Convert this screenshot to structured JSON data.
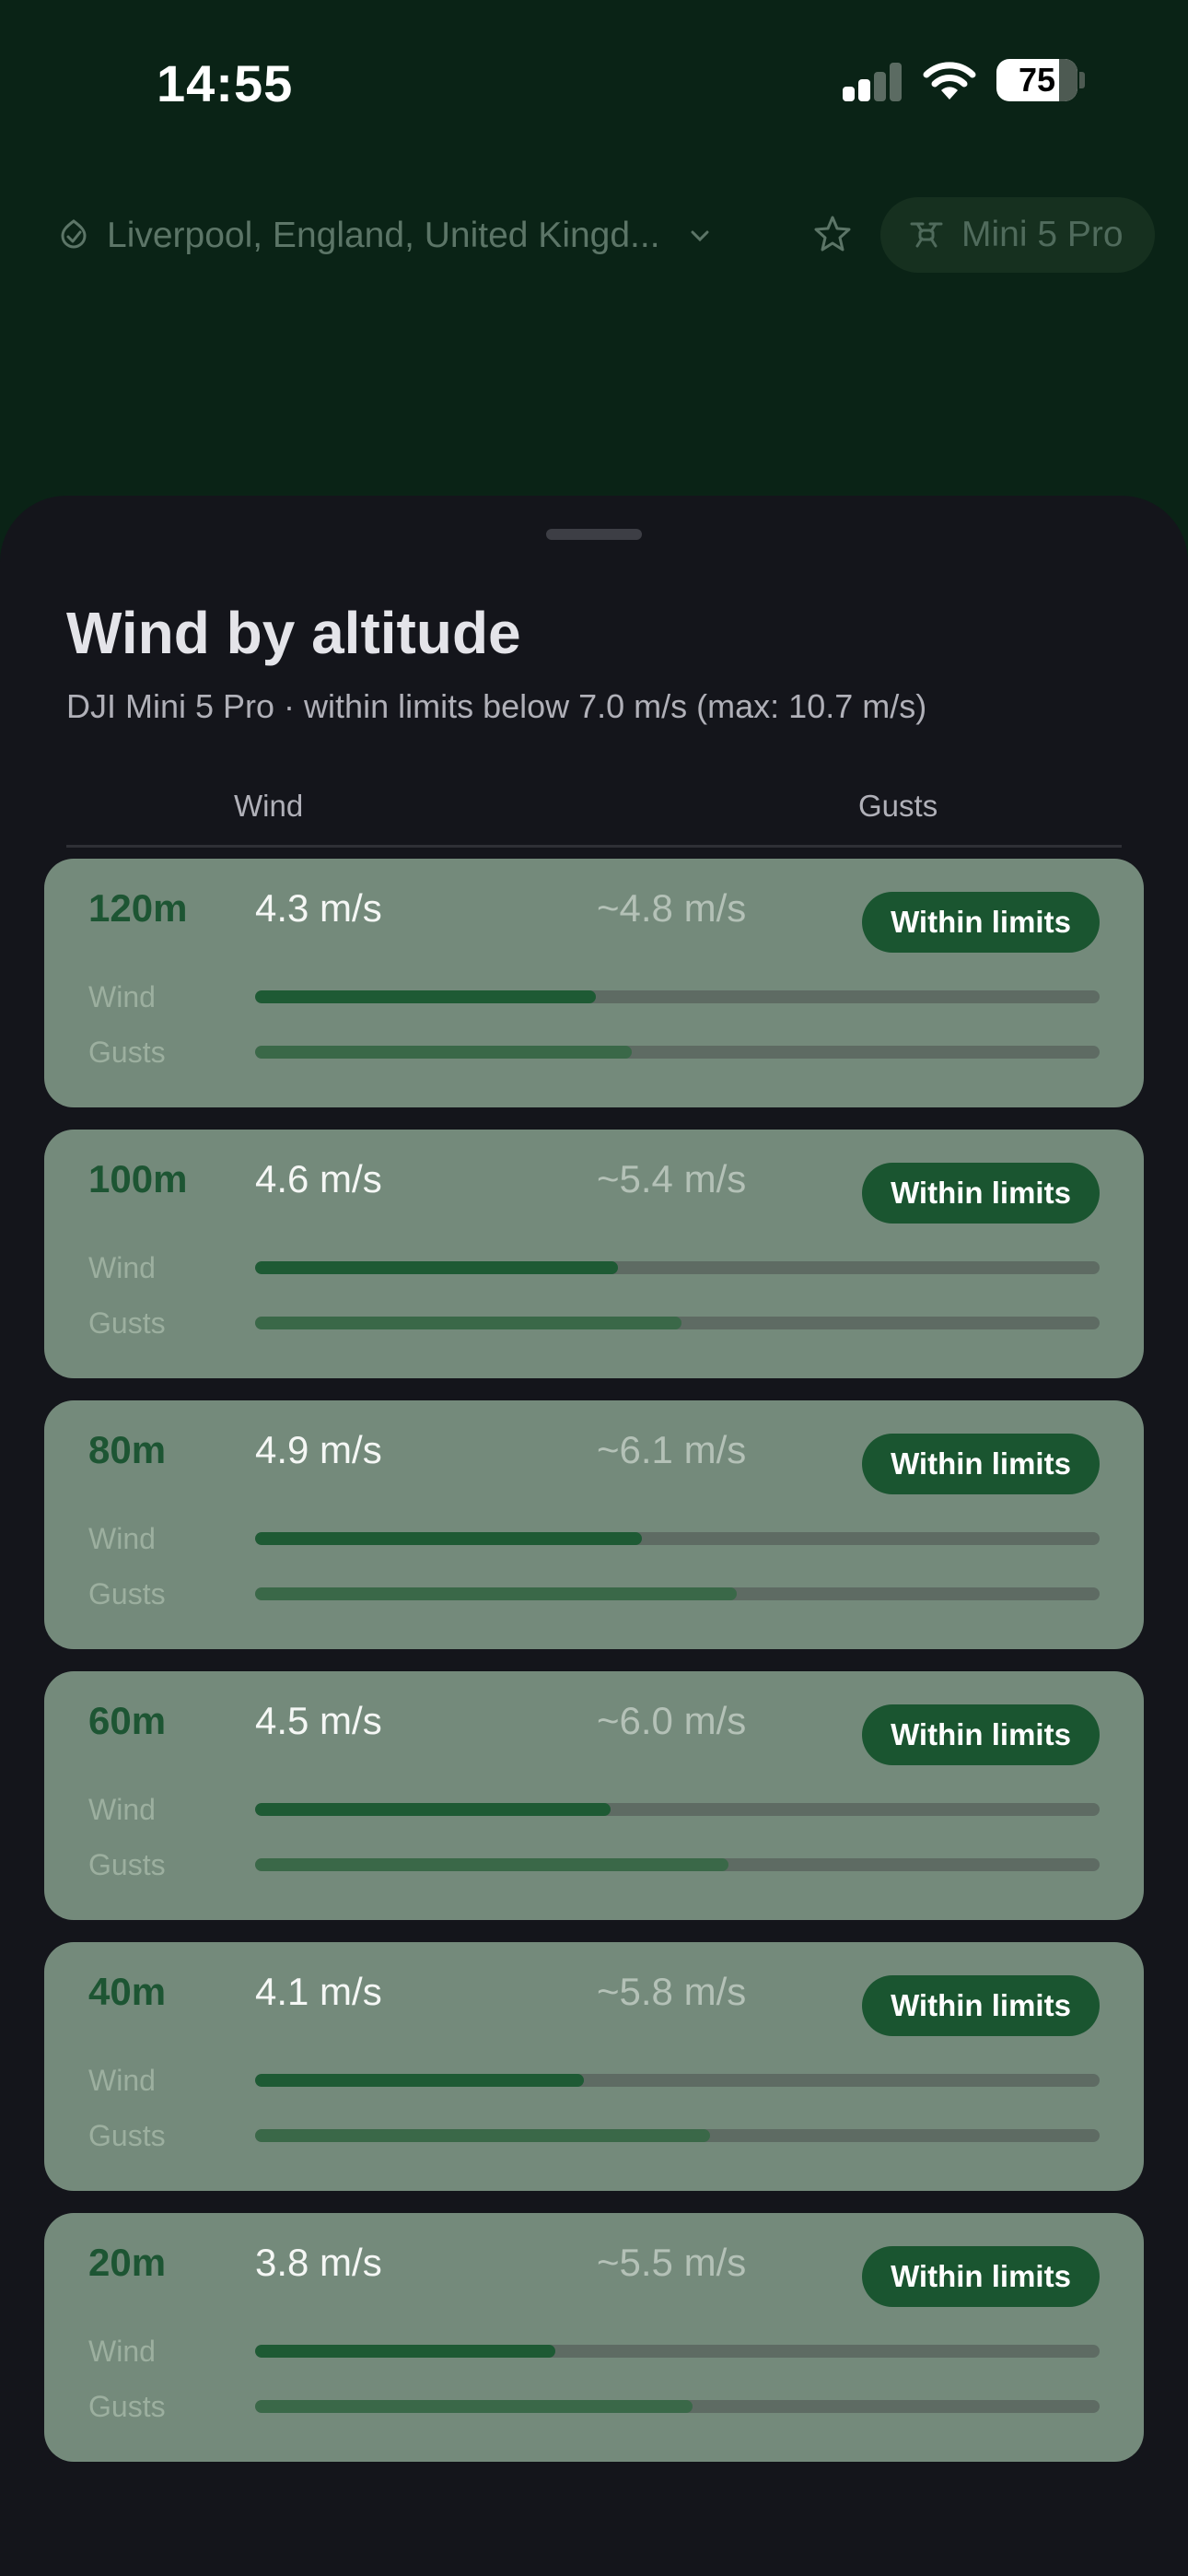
{
  "status_bar": {
    "time": "14:55",
    "battery": "75",
    "signal_icon": "cellular-signal-icon",
    "wifi_icon": "wifi-icon"
  },
  "header": {
    "location": "Liverpool, England, United Kingd...",
    "location_icon": "location-check-icon",
    "dropdown_icon": "chevron-down-icon",
    "favorite_icon": "star-icon",
    "drone": "Mini 5 Pro",
    "drone_icon": "drone-icon"
  },
  "sheet": {
    "title": "Wind by altitude",
    "subtitle": "DJI Mini 5 Pro · within limits below 7.0 m/s  (max: 10.7 m/s)",
    "col_wind": "Wind",
    "col_gusts": "Gusts",
    "row_wind_label": "Wind",
    "row_gusts_label": "Gusts",
    "rows": [
      {
        "altitude": "120m",
        "wind": "4.3 m/s",
        "gusts": "~4.8 m/s",
        "status": "Within limits",
        "wind_fill": 0.403,
        "gust_fill": 0.446
      },
      {
        "altitude": "100m",
        "wind": "4.6 m/s",
        "gusts": "~5.4 m/s",
        "status": "Within limits",
        "wind_fill": 0.43,
        "gust_fill": 0.505
      },
      {
        "altitude": "80m",
        "wind": "4.9 m/s",
        "gusts": "~6.1 m/s",
        "status": "Within limits",
        "wind_fill": 0.458,
        "gust_fill": 0.57
      },
      {
        "altitude": "60m",
        "wind": "4.5 m/s",
        "gusts": "~6.0 m/s",
        "status": "Within limits",
        "wind_fill": 0.421,
        "gust_fill": 0.561
      },
      {
        "altitude": "40m",
        "wind": "4.1 m/s",
        "gusts": "~5.8 m/s",
        "status": "Within limits",
        "wind_fill": 0.389,
        "gust_fill": 0.539
      },
      {
        "altitude": "20m",
        "wind": "3.8 m/s",
        "gusts": "~5.5 m/s",
        "status": "Within limits",
        "wind_fill": 0.355,
        "gust_fill": 0.518
      }
    ]
  },
  "colors": {
    "background": "#0a2316",
    "sheet": "#14151b",
    "card": "#748a7b",
    "accent": "#1a5530"
  }
}
